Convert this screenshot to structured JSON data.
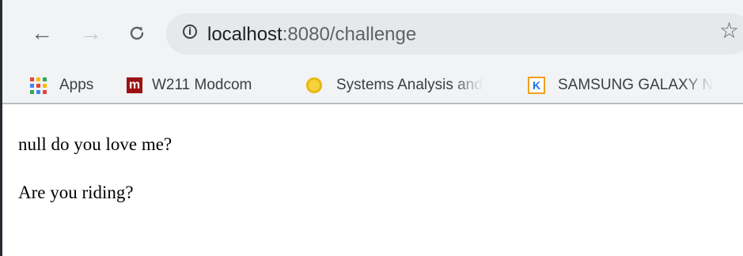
{
  "toolbar": {
    "back_icon": "arrow-left-icon",
    "forward_icon": "arrow-right-icon",
    "reload_icon": "reload-icon",
    "url_host": "localhost",
    "url_path": ":8080/challenge",
    "star_icon": "star-outline-icon"
  },
  "bookmarks": [
    {
      "label": "Apps",
      "icon": "apps-grid-icon"
    },
    {
      "label": "W211 Modcom",
      "icon": "m-logo-icon"
    },
    {
      "label": "Systems Analysis and",
      "icon": "seal-icon"
    },
    {
      "label": "SAMSUNG GALAXY N",
      "icon": "k-logo-icon"
    }
  ],
  "page": {
    "line1": "null do you love me?",
    "line2": "Are you riding?"
  },
  "colors": {
    "chrome_bg": "#f1f3f4",
    "omnibox_bg": "#e6e8ea",
    "apps_grid": [
      "#ea4335",
      "#fbbc05",
      "#34a853",
      "#4285f4",
      "#ea4335",
      "#fbbc05",
      "#34a853",
      "#4285f4",
      "#ea4335"
    ]
  }
}
